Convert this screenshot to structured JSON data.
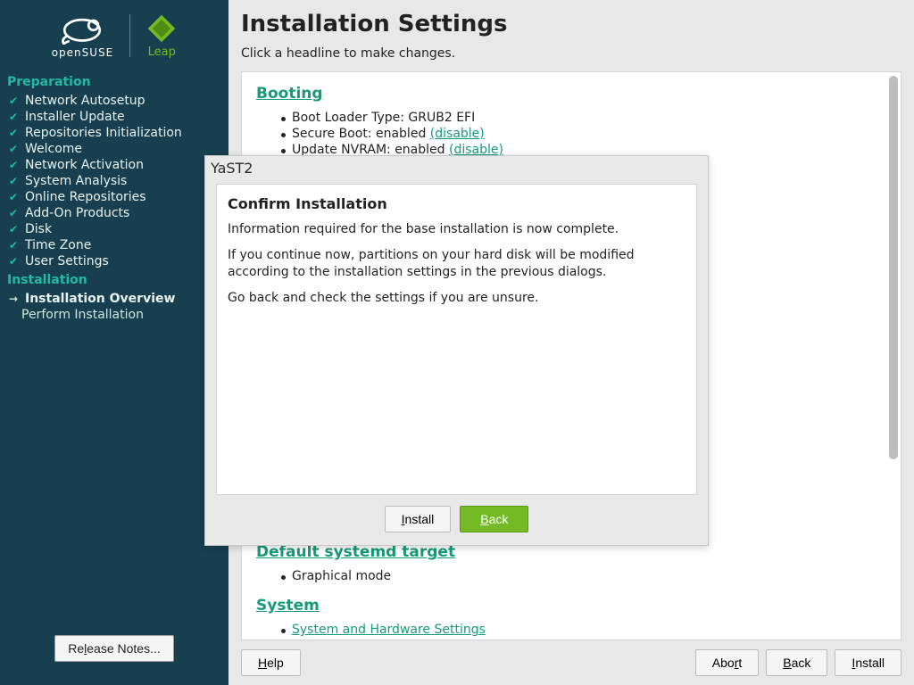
{
  "brand": {
    "os_word": "openSUSE",
    "leap_word": "Leap"
  },
  "sidebar": {
    "section_preparation": "Preparation",
    "prep_items": [
      "Network Autosetup",
      "Installer Update",
      "Repositories Initialization",
      "Welcome",
      "Network Activation",
      "System Analysis",
      "Online Repositories",
      "Add-On Products",
      "Disk",
      "Time Zone",
      "User Settings"
    ],
    "section_installation": "Installation",
    "install_items": {
      "overview": "Installation Overview",
      "perform": "Perform Installation"
    },
    "release_notes": "Release Notes..."
  },
  "main": {
    "title": "Installation Settings",
    "subtitle": "Click a headline to make changes.",
    "sections": {
      "booting": {
        "title": "Booting",
        "bootloader_label": "Boot Loader Type: ",
        "bootloader_value": "GRUB2 EFI",
        "secureboot_label": "Secure Boot: ",
        "secureboot_value": "enabled",
        "secureboot_disable": "(disable)",
        "nvram_label": "Update NVRAM: ",
        "nvram_value": "enabled",
        "nvram_disable": "(disable)"
      },
      "systemd": {
        "title": "Default systemd target",
        "mode": "Graphical mode"
      },
      "system": {
        "title": "System",
        "link": "System and Hardware Settings"
      }
    }
  },
  "footer": {
    "help": "Help",
    "abort": "Abort",
    "back": "Back",
    "install": "Install"
  },
  "modal": {
    "window_title": "YaST2",
    "heading": "Confirm Installation",
    "p1": "Information required for the base installation is now complete.",
    "p2": "If you continue now, partitions on your hard disk will be modified according to the installation settings in the previous dialogs.",
    "p3": "Go back and check the settings if you are unsure.",
    "install": "Install",
    "back": "Back"
  }
}
